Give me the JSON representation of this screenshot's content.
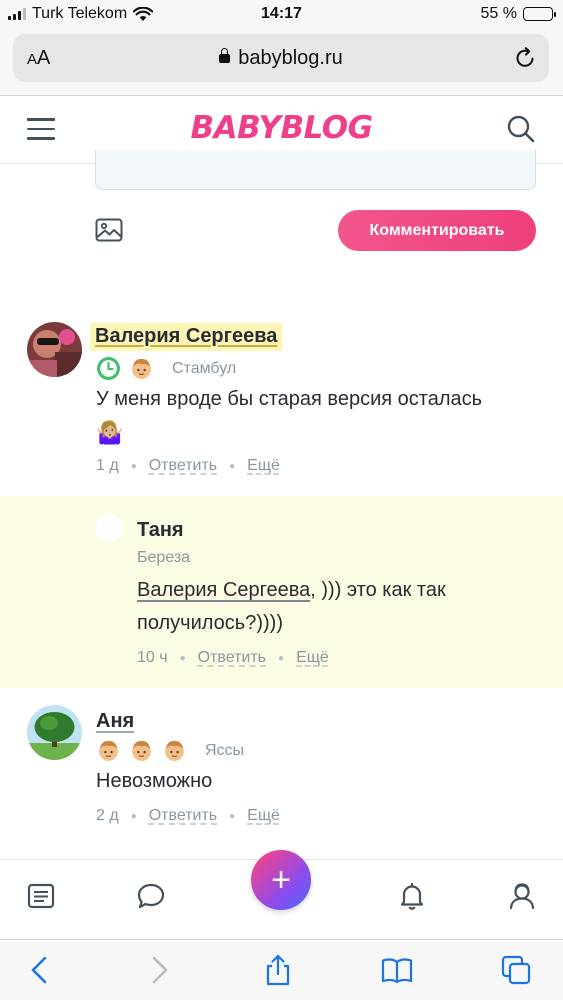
{
  "status_bar": {
    "carrier": "Turk Telekom",
    "time": "14:17",
    "battery": "55 %",
    "battery_level": 0.55
  },
  "browser": {
    "text_size_label_small": "A",
    "text_size_label_large": "A",
    "url": "babyblog.ru"
  },
  "site": {
    "logo": "BABYBLOG"
  },
  "composer": {
    "submit_label": "Комментировать"
  },
  "comments": [
    {
      "author": "Валерия Сергеева",
      "location": "Стамбул",
      "text": "У меня вроде бы старая версия осталась",
      "emoji": "🤷🏼‍♀️",
      "time": "1 д",
      "reply": "Ответить",
      "more": "Ещё"
    },
    {
      "author": "Таня",
      "location": "Береза",
      "mention": "Валерия Сергеева",
      "text_line1": ", ))) это как так",
      "text_line2": "получилось?))))",
      "time": "10 ч",
      "reply": "Ответить",
      "more": "Ещё"
    },
    {
      "author": "Аня",
      "location": "Яссы",
      "text": "Невозможно",
      "time": "2 д",
      "reply": "Ответить",
      "more": "Ещё"
    }
  ],
  "colors": {
    "brand_pink": "#ef3f8a",
    "reply_highlight": "#fcfbe3",
    "name_highlight": "#fbf5b6"
  },
  "icons": {
    "nav": [
      "feed-icon",
      "chat-icon",
      "plus-icon",
      "bell-icon",
      "profile-icon"
    ],
    "toolbar": [
      "back-icon",
      "forward-icon",
      "share-icon",
      "bookmarks-icon",
      "tabs-icon"
    ]
  }
}
